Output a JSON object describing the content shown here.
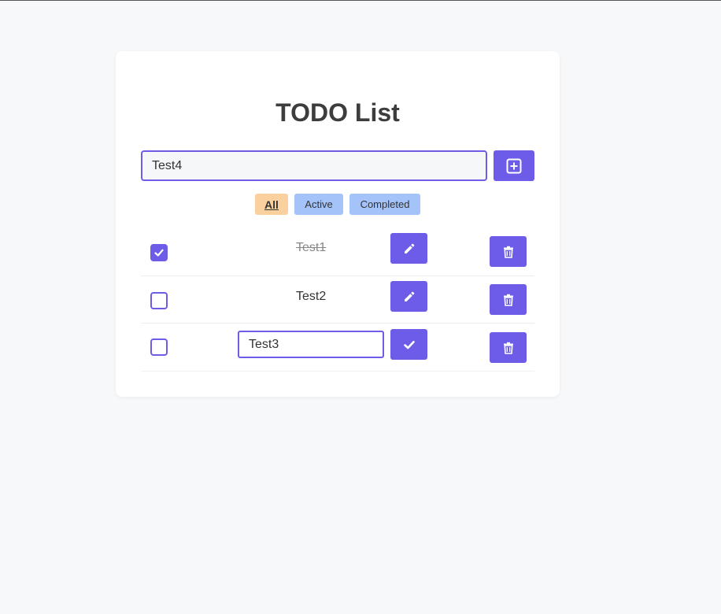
{
  "app": {
    "title": "TODO List"
  },
  "new_todo": {
    "value": "Test4",
    "add_icon": "plus-square-icon"
  },
  "filters": {
    "all": "All",
    "active": "Active",
    "completed": "Completed",
    "selected": "All"
  },
  "todos": [
    {
      "text": "Test1",
      "completed": true,
      "editing": false,
      "action_icon": "pencil-icon",
      "delete_icon": "trash-icon"
    },
    {
      "text": "Test2",
      "completed": false,
      "editing": false,
      "action_icon": "pencil-icon",
      "delete_icon": "trash-icon"
    },
    {
      "text": "Test3",
      "completed": false,
      "editing": true,
      "action_icon": "check-icon",
      "delete_icon": "trash-icon"
    }
  ],
  "colors": {
    "accent": "#6c5ce7",
    "filter_selected": "#fbd09f",
    "filter_default": "#a4c3f8",
    "background": "#f7f8fa"
  }
}
